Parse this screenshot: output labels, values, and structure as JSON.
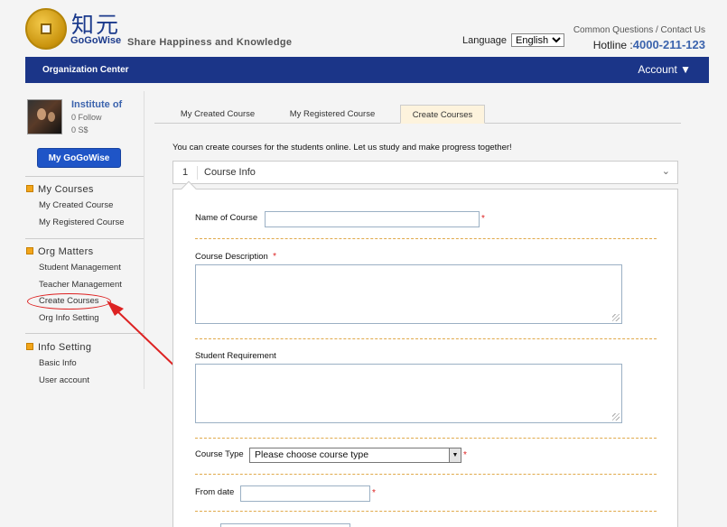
{
  "brand": {
    "cn_name": "知元",
    "en_name": "GoGoWise",
    "slogan": "Share Happiness and Knowledge"
  },
  "header": {
    "language_label": "Language",
    "language_value": "English",
    "links": "Common Questions / Contact Us",
    "hotline_label": "Hotline :",
    "hotline_number": "4000-211-123"
  },
  "navbar": {
    "left": "Organization Center",
    "right": "Account ▼"
  },
  "sidebar": {
    "org_name": "Institute of",
    "follow": "0 Follow",
    "money": "0 S$",
    "my_button": "My GoGoWise",
    "sections": [
      {
        "title": "My Courses",
        "items": [
          "My Created Course",
          "My Registered Course"
        ]
      },
      {
        "title": "Org Matters",
        "items": [
          "Student Management",
          "Teacher Management",
          "Create Courses",
          "Org Info Setting"
        ]
      },
      {
        "title": "Info Setting",
        "items": [
          "Basic Info",
          "User account"
        ]
      }
    ]
  },
  "tabs": [
    "My Created Course",
    "My Registered Course",
    "Create Courses"
  ],
  "active_tab": "Create Courses",
  "intro": "You can create courses for the students online. Let us study and make progress together!",
  "step": {
    "number": "1",
    "title": "Course Info",
    "chevron": "≫"
  },
  "form": {
    "name_label": "Name of Course",
    "description_label": "Course Description",
    "requirement_label": "Student Requirement",
    "type_label": "Course Type",
    "type_value": "Please choose course type",
    "from_label": "From date",
    "required_mark": "*"
  },
  "colors": {
    "navbar": "#1b3588",
    "accent_link": "#3b63ad",
    "button": "#1f55c7",
    "required": "#dd2222",
    "section_marker": "#f2a51a"
  }
}
